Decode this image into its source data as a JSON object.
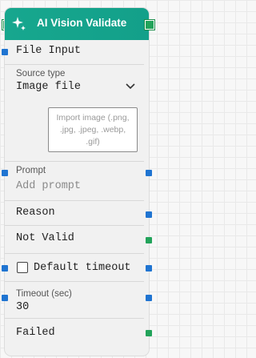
{
  "node": {
    "title": "AI Vision Validate",
    "icon": "vision-sparkle-icon",
    "accent": "#17a78e"
  },
  "file_input": {
    "label": "File Input"
  },
  "source_type": {
    "label": "Source type",
    "value": "Image file",
    "import_hint": "Import image (.png, .jpg, .jpeg, .webp, .gif)"
  },
  "prompt": {
    "label": "Prompt",
    "placeholder": "Add prompt"
  },
  "outputs": {
    "reason": "Reason",
    "not_valid": "Not Valid",
    "failed": "Failed"
  },
  "default_timeout": {
    "label": "Default timeout",
    "checked": false
  },
  "timeout": {
    "label": "Timeout (sec)",
    "value": "30"
  },
  "colors": {
    "port_blue": "#1f74d1",
    "port_green": "#22a35a"
  }
}
